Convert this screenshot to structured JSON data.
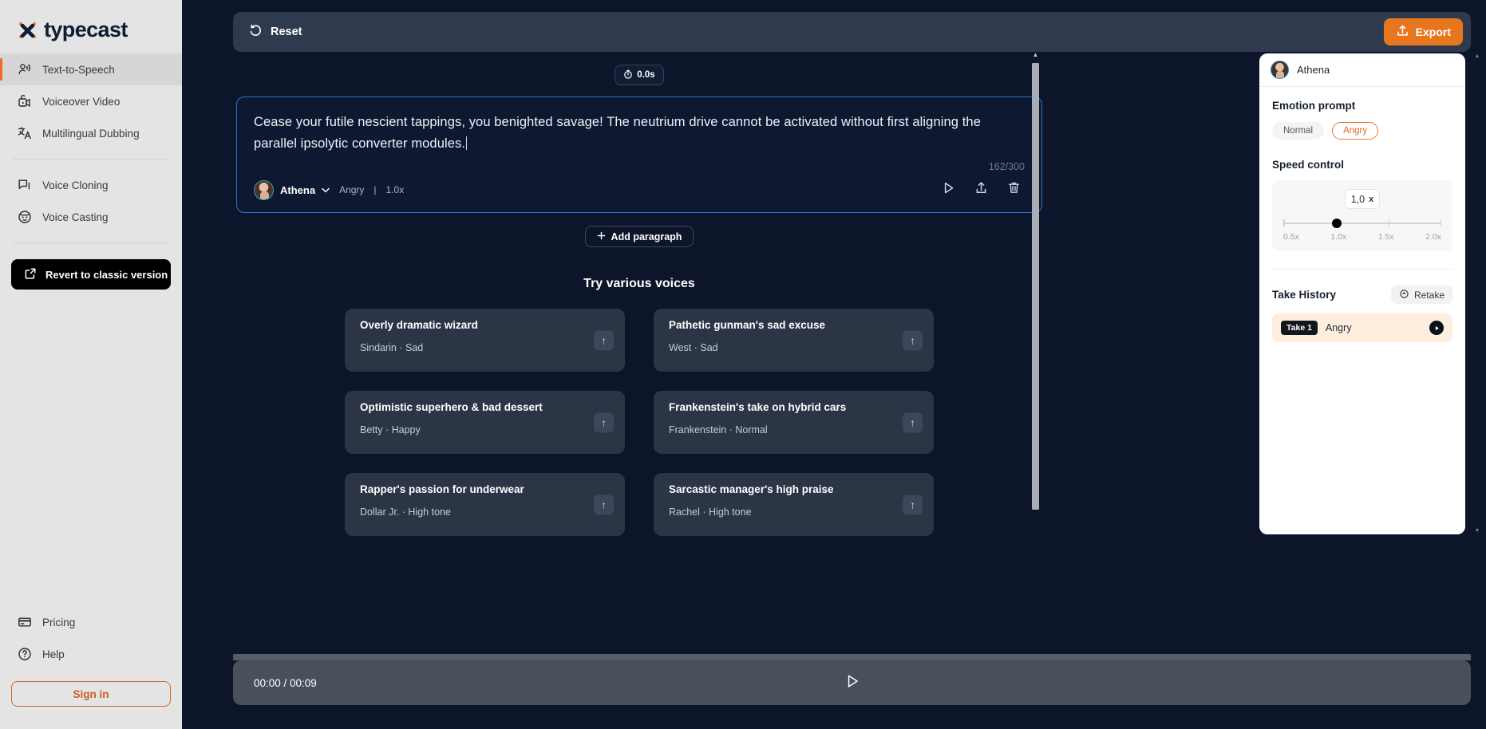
{
  "brand": {
    "name": "typecast"
  },
  "sidebar": {
    "primary_items": [
      {
        "label": "Text-to-Speech",
        "icon": "speech-person-icon",
        "active": true
      },
      {
        "label": "Voiceover Video",
        "icon": "video-camera-icon",
        "active": false
      },
      {
        "label": "Multilingual Dubbing",
        "icon": "translate-icon",
        "active": false
      }
    ],
    "secondary_items": [
      {
        "label": "Voice Cloning",
        "icon": "chat-bubble-icon"
      },
      {
        "label": "Voice Casting",
        "icon": "face-icon"
      }
    ],
    "revert_label": "Revert to classic version",
    "bottom_items": [
      {
        "label": "Pricing",
        "icon": "credit-card-icon"
      },
      {
        "label": "Help",
        "icon": "question-circle-icon"
      }
    ],
    "signin_label": "Sign in"
  },
  "toolbar": {
    "reset_label": "Reset",
    "export_label": "Export"
  },
  "editor": {
    "duration_label": "0.0s",
    "paragraph_text": "Cease your futile nescient tappings, you benighted savage! The neutrium drive cannot be activated without first aligning the parallel ipsolytic converter modules.",
    "char_count": "162/300",
    "voice_name": "Athena",
    "voice_emotion": "Angry",
    "voice_speed": "1.0x",
    "voice_separator": "|",
    "add_paragraph_label": "Add paragraph"
  },
  "suggestions": {
    "title": "Try various voices",
    "cards": [
      {
        "title": "Overly dramatic wizard",
        "sub": "Sindarin · Sad"
      },
      {
        "title": "Pathetic gunman's sad excuse",
        "sub": "West · Sad"
      },
      {
        "title": "Optimistic superhero & bad dessert",
        "sub": "Betty · Happy"
      },
      {
        "title": "Frankenstein's take on hybrid cars",
        "sub": "Frankenstein · Normal"
      },
      {
        "title": "Rapper's passion for underwear",
        "sub": "Dollar Jr. · High tone"
      },
      {
        "title": "Sarcastic manager's high praise",
        "sub": "Rachel · High tone"
      }
    ]
  },
  "right_panel": {
    "voice_name": "Athena",
    "emotion_section_label": "Emotion prompt",
    "emotions": [
      {
        "label": "Normal",
        "selected": false
      },
      {
        "label": "Angry",
        "selected": true
      }
    ],
    "speed_section_label": "Speed control",
    "speed_value": "1,0",
    "speed_unit": "x",
    "speed_ticks": [
      "0.5x",
      "1.0x",
      "1.5x",
      "2.0x"
    ],
    "take_history_label": "Take History",
    "retake_label": "Retake",
    "takes": [
      {
        "badge": "Take 1",
        "emotion": "Angry"
      }
    ]
  },
  "player": {
    "time": "00:00 / 00:09"
  },
  "colors": {
    "accent_orange": "#e8761f",
    "dark_bg": "#0c1529",
    "panel_dark": "#2b3546",
    "focus_blue": "#2e6fd4"
  }
}
